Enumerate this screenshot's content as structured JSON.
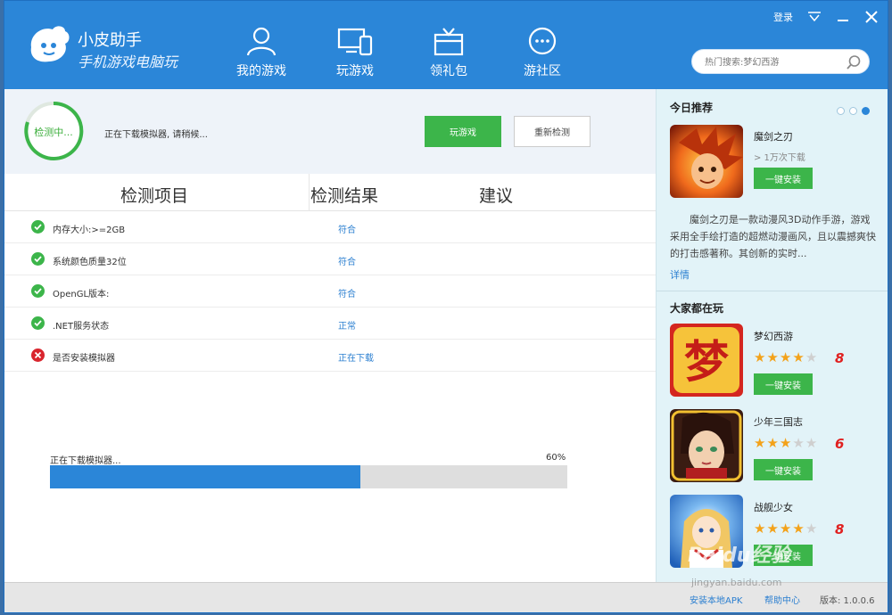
{
  "header": {
    "title": "小皮助手",
    "subtitle": "手机游戏电脑玩",
    "login": "登录",
    "nav": [
      {
        "label": "我的游戏",
        "icon": "user-icon"
      },
      {
        "label": "玩游戏",
        "icon": "devices-icon"
      },
      {
        "label": "领礼包",
        "icon": "gift-icon"
      },
      {
        "label": "游社区",
        "icon": "chat-icon"
      }
    ],
    "search_placeholder": "热门搜索:梦幻西游"
  },
  "status": {
    "ring_label": "检测中...",
    "message": "正在下载模拟器, 请稍候...",
    "play_button": "玩游戏",
    "recheck_button": "重新检测"
  },
  "table": {
    "headers": [
      "检测项目",
      "检测结果",
      "建议"
    ],
    "rows": [
      {
        "name": "内存大小:>=2GB",
        "result": "符合",
        "status": "ok"
      },
      {
        "name": "系统颜色质量32位",
        "result": "符合",
        "status": "ok"
      },
      {
        "name": "OpenGL版本:",
        "result": "符合",
        "status": "ok"
      },
      {
        "name": ".NET服务状态",
        "result": "正常",
        "status": "ok"
      },
      {
        "name": "是否安装模拟器",
        "result": "正在下载",
        "status": "error"
      }
    ]
  },
  "progress": {
    "label": "正在下载模拟器...",
    "percent_text": "60%",
    "percent": 60
  },
  "sidebar": {
    "recommend_title": "今日推荐",
    "featured": {
      "name": "魔剑之刃",
      "downloads": "> 1万次下载",
      "install": "一键安装",
      "description": "魔剑之刃是一款动漫风3D动作手游，游戏采用全手绘打造的超燃动漫画风，且以震撼爽快的打击感著称。其创新的实时...",
      "more": "详情"
    },
    "popular_title": "大家都在玩",
    "popular": [
      {
        "name": "梦幻西游",
        "rating": "8",
        "stars": 4,
        "install": "一键安装"
      },
      {
        "name": "少年三国志",
        "rating": "6",
        "stars": 3,
        "install": "一键安装"
      },
      {
        "name": "战舰少女",
        "rating": "8",
        "stars": 4,
        "install": "一键安装"
      }
    ]
  },
  "footer": {
    "install_apk": "安装本地APK",
    "help": "帮助中心",
    "version": "版本: 1.0.0.6"
  },
  "watermark": {
    "brand": "Baidu经验",
    "url": "jingyan.baidu.com"
  },
  "colors": {
    "header_blue": "#2b86d8",
    "accent_green": "#3cb54a",
    "error_red": "#d9262e",
    "sidebar_bg": "#e2f3f8"
  }
}
